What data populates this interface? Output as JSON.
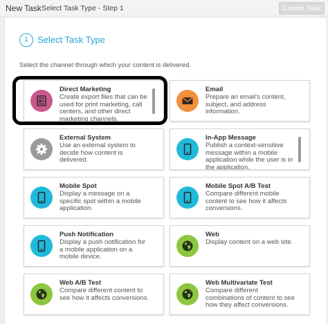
{
  "header": {
    "title": "New Task",
    "step": "Select Task Type - Step 1",
    "create_label": "Create Task"
  },
  "step": {
    "number": "1",
    "title": "Select Task Type"
  },
  "instructions": "Select the channel through which your content is delivered.",
  "colors": {
    "accent": "#2aa3d6",
    "direct_marketing": "#c9588f",
    "email": "#f2913b",
    "external": "#9a9a9a",
    "mobile": "#21b9d9",
    "web": "#8dc63f"
  },
  "cards": [
    {
      "title": "Direct Marketing",
      "desc": "Create export files that can be used for print marketing, call centers, and other direct marketing channels.",
      "icon": "direct-marketing-icon"
    },
    {
      "title": "Email",
      "desc": "Prepare an email's content, subject, and address information.",
      "icon": "email-icon"
    },
    {
      "title": "External System",
      "desc": "Use an external system to decide how content is delivered.",
      "icon": "gear-icon"
    },
    {
      "title": "In-App Message",
      "desc": "Publish a context-sensitive message within a mobile application while the user is in the application.",
      "icon": "mobile-icon"
    },
    {
      "title": "Mobile Spot",
      "desc": "Display a message on a specific spot within a mobile application.",
      "icon": "mobile-icon"
    },
    {
      "title": "Mobile Spot A/B Test",
      "desc": "Compare different mobile content to see how it affects conversions.",
      "icon": "mobile-icon"
    },
    {
      "title": "Push Notification",
      "desc": "Display a push notification for a mobile application on a mobile device.",
      "icon": "mobile-icon"
    },
    {
      "title": "Web",
      "desc": "Display content on a web site.",
      "icon": "globe-icon"
    },
    {
      "title": "Web A/B Test",
      "desc": "Compare different content to see how it affects conversions.",
      "icon": "globe-icon"
    },
    {
      "title": "Web Multivariate Test",
      "desc": "Compare different combinations of content to see how they affect conversions.",
      "icon": "globe-icon"
    }
  ]
}
